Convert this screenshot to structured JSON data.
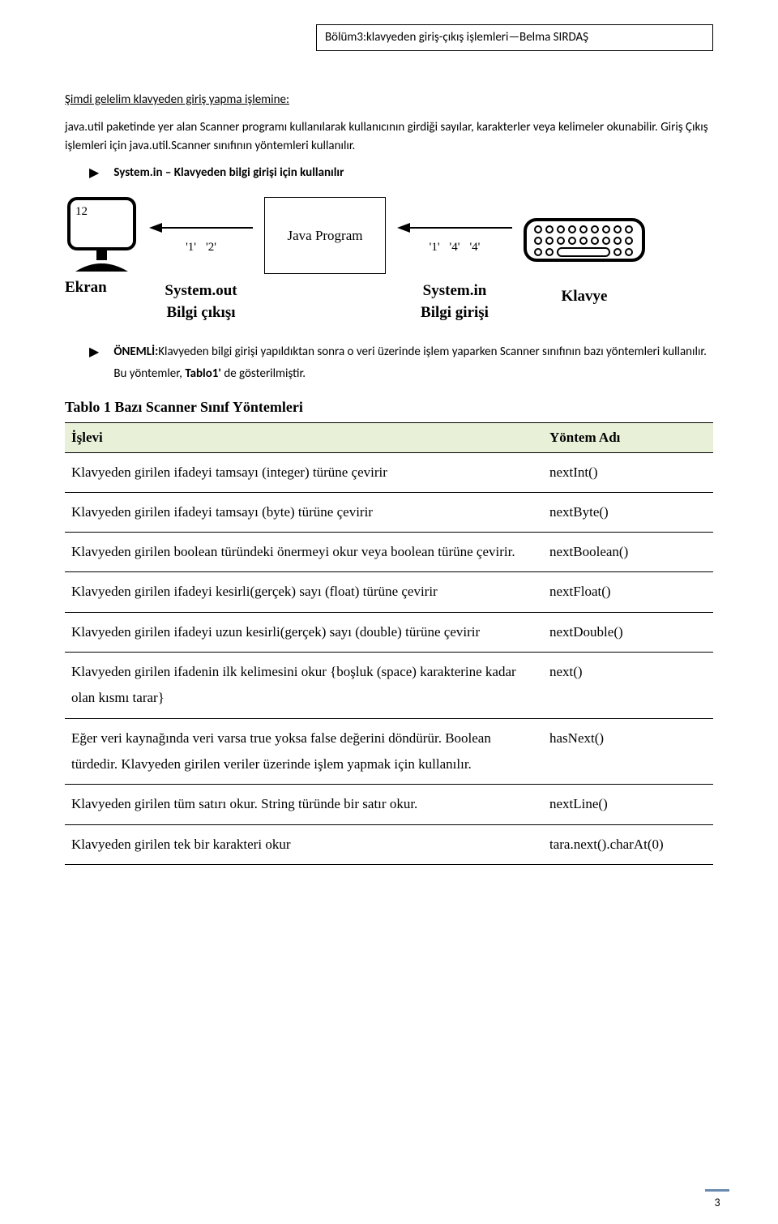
{
  "header": "Bölüm3:klavyeden giriş-çıkış işlemleri—Belma SIRDAŞ",
  "section_title_pre": "Şimdi  gelelim  klavyeden   giriş   yapma  işlemine:",
  "paragraph1": "java.util paketinde yer alan Scanner programı kullanılarak kullanıcının girdiği sayılar, karakterler veya kelimeler okunabilir. Giriş Çıkış işlemleri için java.util.Scanner sınıfının yöntemleri kullanılır.",
  "bullet1": "System.in – Klavyeden bilgi girişi için kullanılır",
  "diagram": {
    "monitor_number": "12",
    "out_seq": [
      "'1'",
      "'2'"
    ],
    "program_label": "Java Program",
    "in_seq": [
      "'1'",
      "'4'",
      "'4'"
    ],
    "system_out": "System.out",
    "bilgi_cikisi": "Bilgi çıkışı",
    "system_in": "System.in",
    "bilgi_girisi": "Bilgi girişi",
    "ekran": "Ekran",
    "klavye": "Klavye"
  },
  "bullet2_label": "ÖNEMLİ:",
  "bullet2_text": "Klavyeden bilgi girişi yapıldıktan sonra o veri üzerinde işlem yaparken Scanner sınıfının bazı yöntemleri kullanılır.",
  "bullet2_sub": "Bu yöntemler, Tablo1' de gösterilmiştir.",
  "table_caption": "Tablo 1 Bazı Scanner Sınıf Yöntemleri",
  "table": {
    "headers": {
      "col1": "İşlevi",
      "col2": "Yöntem Adı"
    },
    "rows": [
      {
        "desc": "Klavyeden girilen ifadeyi tamsayı  (integer) türüne çevirir",
        "method": "nextInt()"
      },
      {
        "desc": "Klavyeden girilen ifadeyi tamsayı  (byte) türüne çevirir",
        "method": "nextByte()"
      },
      {
        "desc": "Klavyeden girilen boolean türündeki önermeyi okur veya boolean türüne çevirir.",
        "method": "nextBoolean()"
      },
      {
        "desc": "Klavyeden  girilen  ifadeyi  kesirli(gerçek)  sayı   (float)  türüne çevirir",
        "method": "nextFloat()"
      },
      {
        "desc": "Klavyeden  girilen  ifadeyi  uzun  kesirli(gerçek)  sayı   (double) türüne çevirir",
        "method": "nextDouble()"
      },
      {
        "desc": "Klavyeden girilen ifadenin ilk kelimesini okur   {boşluk (space) karakterine kadar olan kısmı tarar}",
        "method": "next()"
      },
      {
        "desc": "Eğer  veri  kaynağında  veri  varsa  true  yoksa  false  değerini döndürür.  Boolean türdedir. Klavyeden girilen veriler üzerinde işlem yapmak için kullanılır.",
        "method": "hasNext()"
      },
      {
        "desc": "Klavyeden girilen tüm satırı okur. String türünde bir satır okur.",
        "method": "nextLine()"
      },
      {
        "desc": "Klavyeden girilen tek bir karakteri okur",
        "method": "tara.next().charAt(0)"
      }
    ]
  },
  "page_number": "3"
}
